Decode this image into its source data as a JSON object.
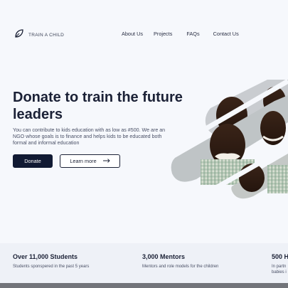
{
  "brand": {
    "name": "TRAIN A CHILD",
    "logo_icon": "leaf-icon"
  },
  "nav": {
    "links": [
      "About Us",
      "Projects",
      "FAQs",
      "Contact Us"
    ]
  },
  "hero": {
    "title": "Donate to train the future leaders",
    "description": "You can contribute to kids education with as low as #500. We are an NGO whose goals is to finance and helps kids to be educated both formal and informal education",
    "donate_label": "Donate",
    "learn_more_label": "Learn more",
    "learn_more_icon": "arrow-right-icon"
  },
  "stats": [
    {
      "title": "Over 11,000 Students",
      "subtitle": "Students sponspered in the past 5 years"
    },
    {
      "title": "3,000 Mentors",
      "subtitle": "Mentors and role models for the children"
    },
    {
      "title": "500 H",
      "subtitle": "In partn",
      "subtitle2": "babies i"
    }
  ],
  "colors": {
    "background": "#f6f8fc",
    "primary": "#111a33",
    "stats_band": "#eef1f7",
    "footer_bar": "#72747a"
  }
}
